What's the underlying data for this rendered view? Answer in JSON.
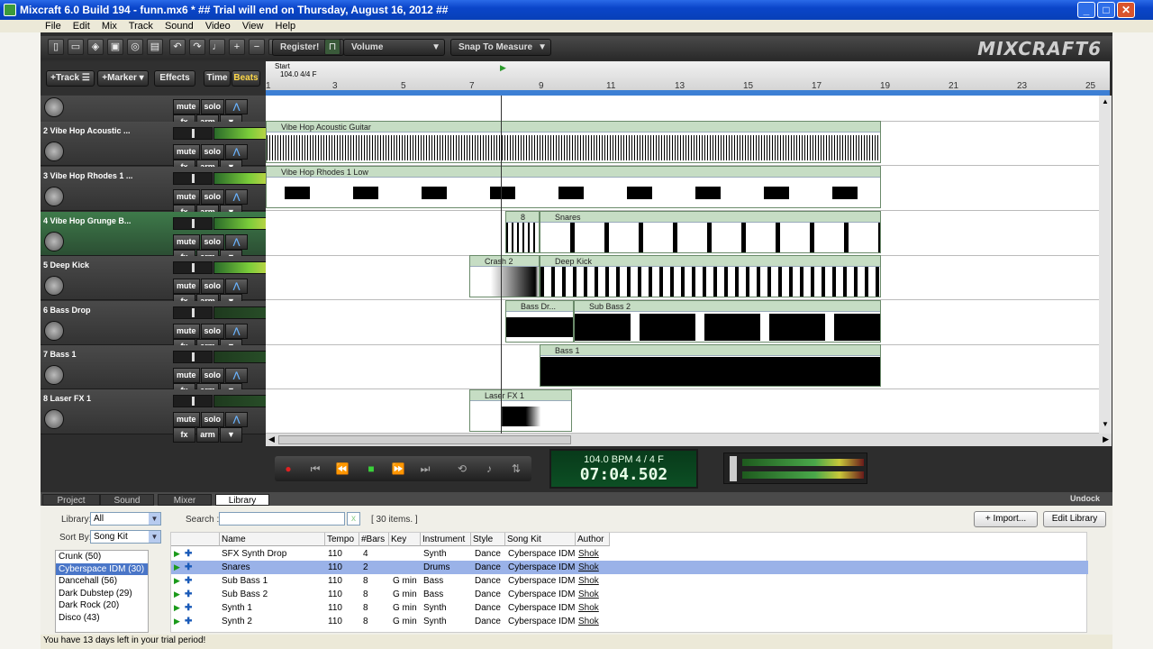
{
  "window": {
    "title": "Mixcraft 6.0 Build 194 - funn.mx6 *   ## Trial will end on Thursday, August 16, 2012 ##"
  },
  "menu": [
    "File",
    "Edit",
    "Mix",
    "Track",
    "Sound",
    "Video",
    "View",
    "Help"
  ],
  "toolbar": {
    "register": "Register!",
    "volume": "Volume",
    "snap": "Snap To Measure",
    "logo": "MIXCRAFT6"
  },
  "trackhead": {
    "track": "+Track",
    "marker": "+Marker",
    "effects": "Effects",
    "time": "Time",
    "beats": "Beats"
  },
  "ruler": {
    "start": "Start",
    "sig": "104.0 4/4 F",
    "numbers": [
      "1",
      "3",
      "5",
      "7",
      "9",
      "11",
      "13",
      "15",
      "17",
      "19",
      "21",
      "23",
      "25"
    ]
  },
  "tracks": [
    {
      "name": "",
      "mute": "mute",
      "solo": "solo",
      "fx": "fx",
      "arm": "arm"
    },
    {
      "name": "2 Vibe Hop Acoustic ...",
      "mute": "mute",
      "solo": "solo",
      "fx": "fx",
      "arm": "arm"
    },
    {
      "name": "3 Vibe Hop Rhodes 1 ...",
      "mute": "mute",
      "solo": "solo",
      "fx": "fx",
      "arm": "arm"
    },
    {
      "name": "4 Vibe Hop Grunge B...",
      "mute": "mute",
      "solo": "solo",
      "fx": "fx",
      "arm": "arm"
    },
    {
      "name": "5 Deep Kick",
      "mute": "mute",
      "solo": "solo",
      "fx": "fx",
      "arm": "arm"
    },
    {
      "name": "6 Bass Drop",
      "mute": "mute",
      "solo": "solo",
      "fx": "fx",
      "arm": "arm"
    },
    {
      "name": "7 Bass 1",
      "mute": "mute",
      "solo": "solo",
      "fx": "fx",
      "arm": "arm"
    },
    {
      "name": "8 Laser FX 1",
      "mute": "mute",
      "solo": "solo",
      "fx": "fx",
      "arm": "arm"
    }
  ],
  "clips": {
    "guitar": "Vibe Hop Acoustic Guitar",
    "rhodes": "Vibe Hop Rhodes 1 Low",
    "s8": "8",
    "snares": "Snares",
    "crash": "Crash 2",
    "deepkick": "Deep Kick",
    "bassdr": "Bass Dr...",
    "subbass": "Sub Bass 2",
    "bass1": "Bass 1",
    "laser": "Laser FX 1"
  },
  "transport": {
    "bpm": "104.0 BPM   4 / 4   F",
    "time": "07:04.502"
  },
  "tabs": [
    "Project",
    "Sound",
    "Mixer",
    "Library"
  ],
  "undock": "Undock",
  "library": {
    "library_label": "Library:",
    "library_value": "All",
    "sort_label": "Sort By:",
    "sort_value": "Song Kit",
    "search_label": "Search :",
    "search_value": "",
    "count": "[ 30 items. ]",
    "import": "+ Import...",
    "edit": "Edit Library",
    "kits": [
      "Crunk  (50)",
      "Cyberspace IDM  (30)",
      "Dancehall  (56)",
      "Dark Dubstep  (29)",
      "Dark Rock  (20)",
      "Disco  (43)"
    ],
    "columns": [
      "Name",
      "Tempo",
      "#Bars",
      "Key",
      "Instrument",
      "Style",
      "Song Kit",
      "Author"
    ],
    "rows": [
      {
        "name": "SFX Synth Drop",
        "tempo": "110",
        "bars": "4",
        "key": "",
        "inst": "Synth",
        "style": "Dance",
        "kit": "Cyberspace IDM",
        "author": "Shok"
      },
      {
        "name": "Snares",
        "tempo": "110",
        "bars": "2",
        "key": "",
        "inst": "Drums",
        "style": "Dance",
        "kit": "Cyberspace IDM",
        "author": "Shok"
      },
      {
        "name": "Sub Bass 1",
        "tempo": "110",
        "bars": "8",
        "key": "G min",
        "inst": "Bass",
        "style": "Dance",
        "kit": "Cyberspace IDM",
        "author": "Shok"
      },
      {
        "name": "Sub Bass 2",
        "tempo": "110",
        "bars": "8",
        "key": "G min",
        "inst": "Bass",
        "style": "Dance",
        "kit": "Cyberspace IDM",
        "author": "Shok"
      },
      {
        "name": "Synth 1",
        "tempo": "110",
        "bars": "8",
        "key": "G min",
        "inst": "Synth",
        "style": "Dance",
        "kit": "Cyberspace IDM",
        "author": "Shok"
      },
      {
        "name": "Synth 2",
        "tempo": "110",
        "bars": "8",
        "key": "G min",
        "inst": "Synth",
        "style": "Dance",
        "kit": "Cyberspace IDM",
        "author": "Shok"
      }
    ]
  },
  "status": "You have 13 days left in your trial period!"
}
